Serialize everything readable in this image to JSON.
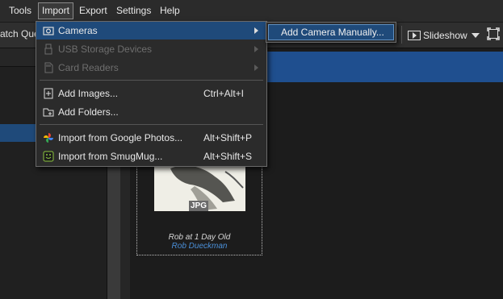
{
  "menubar": {
    "items": [
      "Tools",
      "Import",
      "Export",
      "Settings",
      "Help"
    ]
  },
  "toolbar": {
    "left_label": "atch Que",
    "slideshow_label": "Slideshow"
  },
  "import_menu": {
    "cameras": "Cameras",
    "usb": "USB Storage Devices",
    "card_readers": "Card Readers",
    "add_images": "Add Images...",
    "add_images_shortcut": "Ctrl+Alt+I",
    "add_folders": "Add Folders...",
    "google_photos": "Import from Google Photos...",
    "google_photos_shortcut": "Alt+Shift+P",
    "smugmug": "Import from SmugMug...",
    "smugmug_shortcut": "Alt+Shift+S"
  },
  "submenu": {
    "add_camera": "Add Camera Manually..."
  },
  "thumbnail": {
    "badge": "JPG",
    "caption": "Rob at 1 Day Old",
    "author": "Rob Dueckman"
  },
  "colors": {
    "accent": "#1f4a7a",
    "link": "#4a8fd8"
  }
}
